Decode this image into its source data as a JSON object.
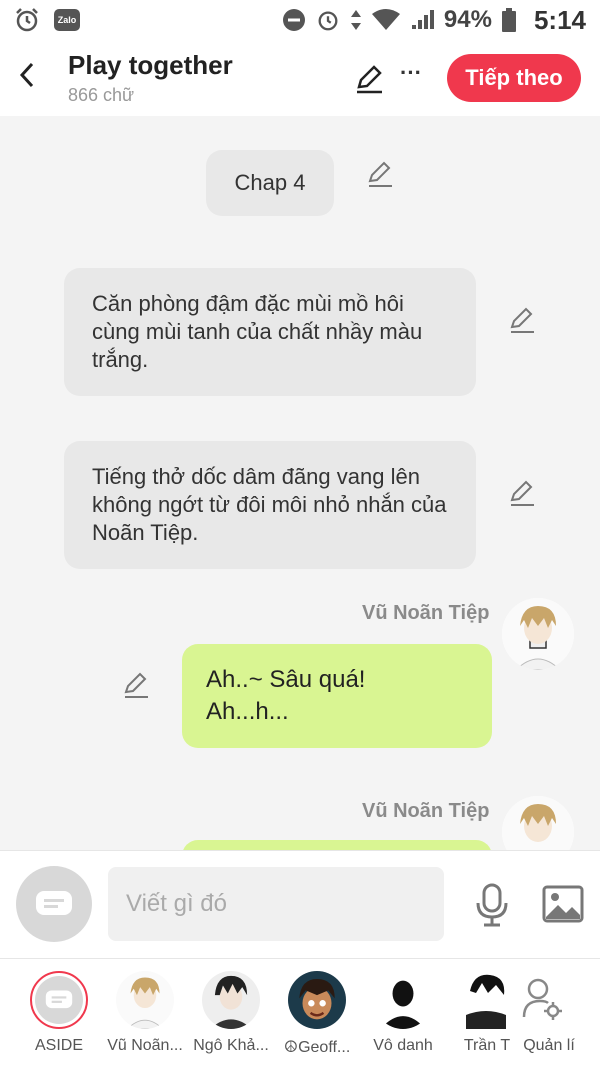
{
  "status_bar": {
    "battery": "94%",
    "time": "5:14",
    "app_badge": "Zalo"
  },
  "header": {
    "title": "Play together",
    "word_count": "866 chữ",
    "next_label": "Tiếp theo",
    "more_label": "···"
  },
  "messages": {
    "chapter": "Chap 4",
    "narration_1": "Căn phòng đậm đặc mùi mồ hôi cùng mùi tanh của chất nhầy màu trắng.",
    "narration_2": "Tiếng thở dốc dâm đãng vang lên không ngớt từ đôi môi nhỏ nhắn của Noãn Tiệp.",
    "speaker_1": "Vũ Noãn Tiệp",
    "dialog_1": "Ah..~ Sâu quá!\nAh...h...",
    "speaker_2": "Vũ Noãn Tiệp"
  },
  "composer": {
    "placeholder": "Viết gì đó"
  },
  "characters": [
    {
      "label": "ASIDE"
    },
    {
      "label": "Vũ Noãn..."
    },
    {
      "label": "Ngô Khả..."
    },
    {
      "label": "☮Geoff..."
    },
    {
      "label": "Vô danh"
    },
    {
      "label": "Trần T"
    },
    {
      "label": "Quản lí"
    }
  ],
  "colors": {
    "accent": "#f0384d",
    "dialog_bubble": "#d9f592",
    "narration_bubble": "#e8e8e8"
  }
}
